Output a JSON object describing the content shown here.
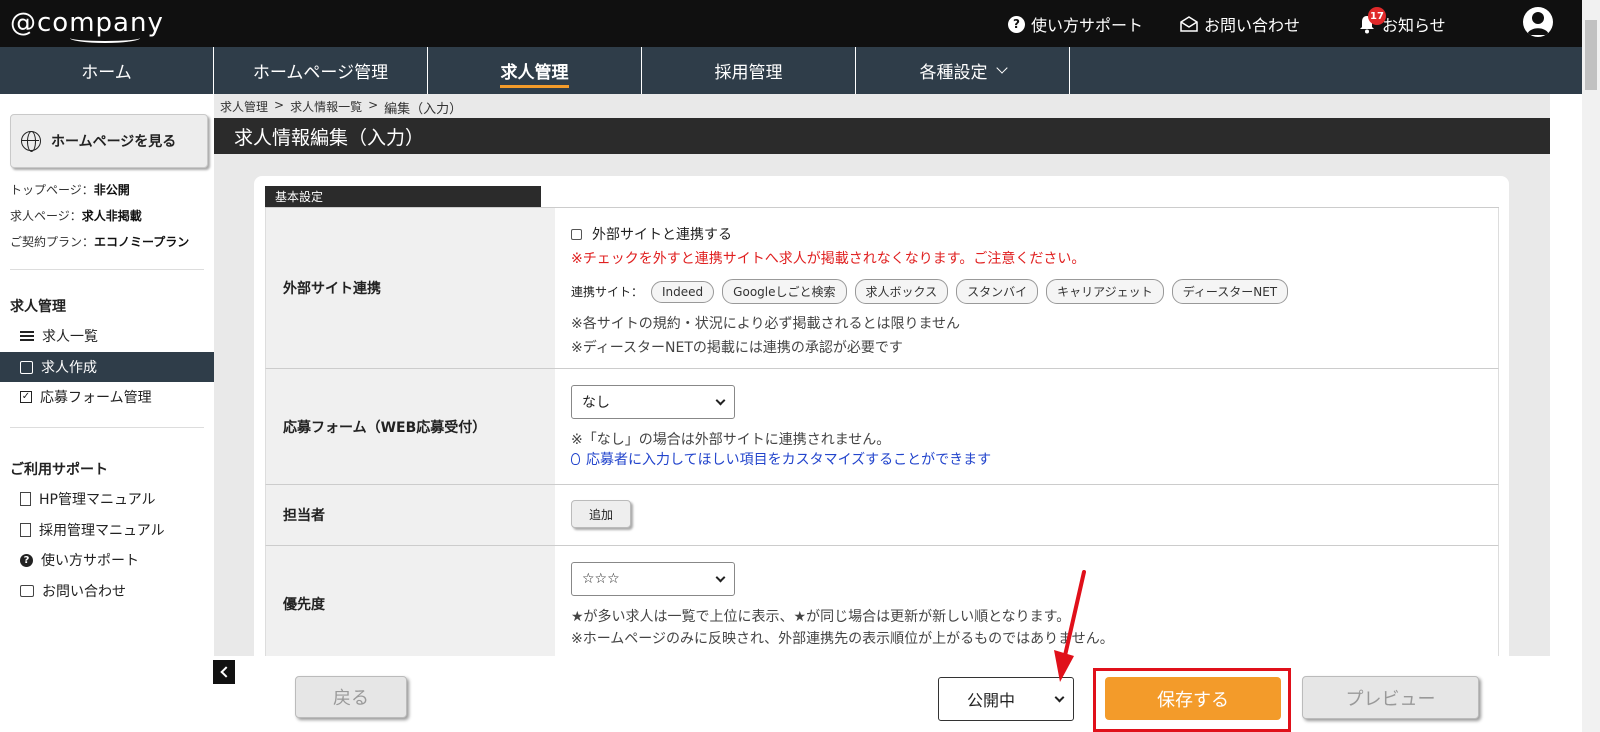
{
  "app": {
    "logo_text": "@company"
  },
  "topbar": {
    "help_label": "使い方サポート",
    "contact_label": "お問い合わせ",
    "notice_label": "お知らせ",
    "notice_count": "17"
  },
  "nav": {
    "items": [
      {
        "label": "ホーム"
      },
      {
        "label": "ホームページ管理"
      },
      {
        "label": "求人管理"
      },
      {
        "label": "採用管理"
      },
      {
        "label": "各種設定"
      }
    ],
    "active_index": 2
  },
  "sidebar": {
    "hp_button": "ホームページを見る",
    "status": [
      {
        "label": "トップページ：",
        "value": "非公開"
      },
      {
        "label": "求人ページ：",
        "value": "求人非掲載"
      },
      {
        "label": "ご契約プラン：",
        "value": "エコノミープラン"
      }
    ],
    "section1_title": "求人管理",
    "section1_items": [
      {
        "label": "求人一覧"
      },
      {
        "label": "求人作成"
      },
      {
        "label": "応募フォーム管理"
      }
    ],
    "section2_title": "ご利用サポート",
    "section2_items": [
      {
        "label": "HP管理マニュアル"
      },
      {
        "label": "採用管理マニュアル"
      },
      {
        "label": "使い方サポート"
      },
      {
        "label": "お問い合わせ"
      }
    ]
  },
  "breadcrumb": {
    "items": [
      "求人管理",
      ">",
      "求人情報一覧",
      ">"
    ],
    "current": "編集（入力）"
  },
  "page_title": "求人情報編集（入力）",
  "section_tab": "基本設定",
  "rows": {
    "external": {
      "label": "外部サイト連携",
      "checkbox_label": "外部サイトと連携する",
      "warning": "※チェックを外すと連携サイトへ求人が掲載されなくなります。ご注意ください。",
      "partners_label": "連携サイト：",
      "partners": [
        "Indeed",
        "Googleしごと検索",
        "求人ボックス",
        "スタンバイ",
        "キャリアジェット",
        "ディースターNET"
      ],
      "note1": "※各サイトの規約・状況により必ず掲載されるとは限りません",
      "note2": "※ディースターNETの掲載には連携の承認が必要です"
    },
    "form": {
      "label": "応募フォーム（WEB応募受付）",
      "select_value": "なし",
      "note": "※「なし」の場合は外部サイトに連携されません。",
      "link": "応募者に入力してほしい項目をカスタマイズすることができます"
    },
    "person": {
      "label": "担当者",
      "add_button": "追加"
    },
    "priority": {
      "label": "優先度",
      "select_value": "☆☆☆",
      "note1": "★が多い求人は一覧で上位に表示、★が同じ場合は更新が新しい順となります。",
      "note2": "※ホームページのみに反映され、外部連携先の表示順位が上がるものではありません。"
    }
  },
  "footer": {
    "back_button": "戻る",
    "status_select": "公開中",
    "save_button": "保存する",
    "preview_button": "プレビュー"
  },
  "colors": {
    "accent": "#f39b2a",
    "nav_bg": "#2f3d49",
    "warning": "#e02020",
    "highlight": "#e0101a"
  }
}
